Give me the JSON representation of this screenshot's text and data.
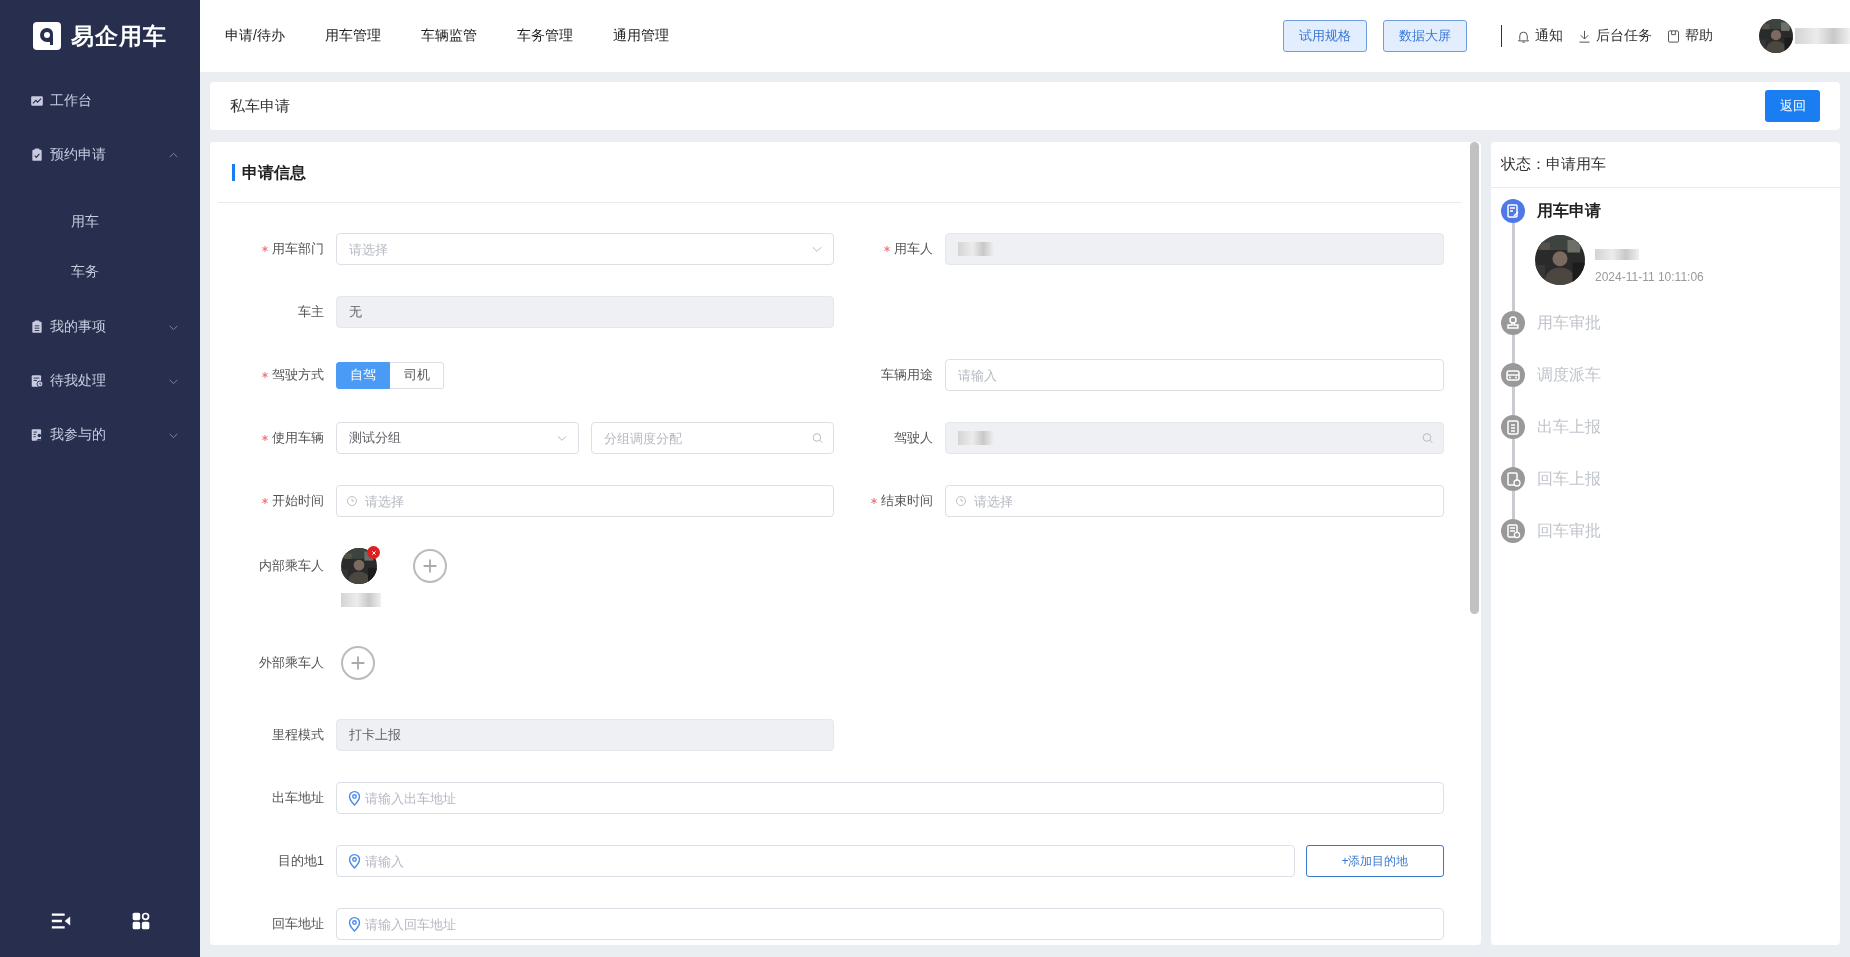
{
  "sidebar": {
    "logo": "易企用车",
    "items": [
      {
        "label": "工作台",
        "kind": "dashboard"
      },
      {
        "label": "预约申请",
        "kind": "booking",
        "expanded": true,
        "children": [
          {
            "label": "用车",
            "selected": false
          },
          {
            "label": "车务",
            "selected": false
          }
        ]
      },
      {
        "label": "我的事项",
        "kind": "matters",
        "expanded": false
      },
      {
        "label": "待我处理",
        "kind": "pending",
        "expanded": false
      },
      {
        "label": "我参与的",
        "kind": "involved",
        "expanded": false
      }
    ]
  },
  "top_nav": [
    {
      "label": "申请/待办",
      "selected": false
    },
    {
      "label": "用车管理",
      "selected": false
    },
    {
      "label": "车辆监管",
      "selected": false
    },
    {
      "label": "车务管理",
      "selected": false
    },
    {
      "label": "通用管理",
      "selected": false
    }
  ],
  "toolbar": {
    "buttons": [
      "试用规格",
      "数据大屏"
    ],
    "links": [
      {
        "label": "通知",
        "kind": "bell"
      },
      {
        "label": "后台任务",
        "kind": "download"
      },
      {
        "label": "帮助",
        "kind": "help"
      }
    ]
  },
  "page": {
    "title": "私车申请",
    "back_button": "返回"
  },
  "form": {
    "section_title": "申请信息",
    "rows": [
      {
        "fields": [
          {
            "label": "用车部门",
            "required": true,
            "kind": "select",
            "placeholder": "请选择"
          },
          {
            "label": "用车人",
            "required": true,
            "kind": "text",
            "disabled": true,
            "redacted": true
          }
        ]
      },
      {
        "fields": [
          {
            "label": "车主",
            "required": false,
            "kind": "text",
            "disabled": true,
            "value": "无"
          }
        ]
      },
      {
        "fields": [
          {
            "label": "驾驶方式",
            "required": true,
            "kind": "segmented",
            "options": [
              {
                "label": "自驾",
                "selected": true
              },
              {
                "label": "司机",
                "selected": false
              }
            ]
          },
          {
            "label": "车辆用途",
            "required": false,
            "kind": "text",
            "disabled": false,
            "placeholder": "请输入"
          }
        ]
      },
      {
        "fields": [
          {
            "label": "使用车辆",
            "required": true,
            "kind": "select-search",
            "value": "测试分组",
            "search_placeholder": "分组调度分配"
          },
          {
            "label": "驾驶人",
            "required": false,
            "kind": "search",
            "disabled": true,
            "redacted": true
          }
        ]
      },
      {
        "fields": [
          {
            "label": "开始时间",
            "required": true,
            "kind": "datetime",
            "placeholder": "请选择"
          },
          {
            "label": "结束时间",
            "required": true,
            "kind": "datetime",
            "placeholder": "请选择"
          }
        ]
      },
      {
        "fields": [
          {
            "label": "内部乘车人",
            "required": false,
            "kind": "passengers",
            "passengers": [
              {
                "removable": true
              }
            ]
          }
        ]
      },
      {
        "fields": [
          {
            "label": "外部乘车人",
            "required": false,
            "kind": "passengers"
          }
        ]
      },
      {
        "fields": [
          {
            "label": "里程模式",
            "required": false,
            "kind": "text",
            "disabled": true,
            "value": "打卡上报"
          }
        ]
      },
      {
        "fields": [
          {
            "label": "出车地址",
            "required": false,
            "kind": "address",
            "placeholder": "请输入出车地址"
          }
        ]
      },
      {
        "fields": [
          {
            "label": "目的地1",
            "required": false,
            "kind": "address",
            "placeholder": "请输入",
            "add_button": "+添加目的地"
          }
        ]
      },
      {
        "fields": [
          {
            "label": "回车地址",
            "required": false,
            "kind": "address",
            "placeholder": "请输入回车地址"
          }
        ]
      }
    ]
  },
  "timeline": {
    "status": "状态：申请用车",
    "steps": [
      {
        "label": "用车申请",
        "kind": "edit",
        "done": true,
        "time": "2024-11-11 10:11:06"
      },
      {
        "label": "用车审批",
        "kind": "stamp",
        "done": false
      },
      {
        "label": "调度派车",
        "kind": "car",
        "done": false
      },
      {
        "label": "出车上报",
        "kind": "clipboard",
        "done": false
      },
      {
        "label": "回车上报",
        "kind": "document-clock",
        "done": false
      },
      {
        "label": "回车审批",
        "kind": "document-check",
        "done": false
      }
    ]
  }
}
